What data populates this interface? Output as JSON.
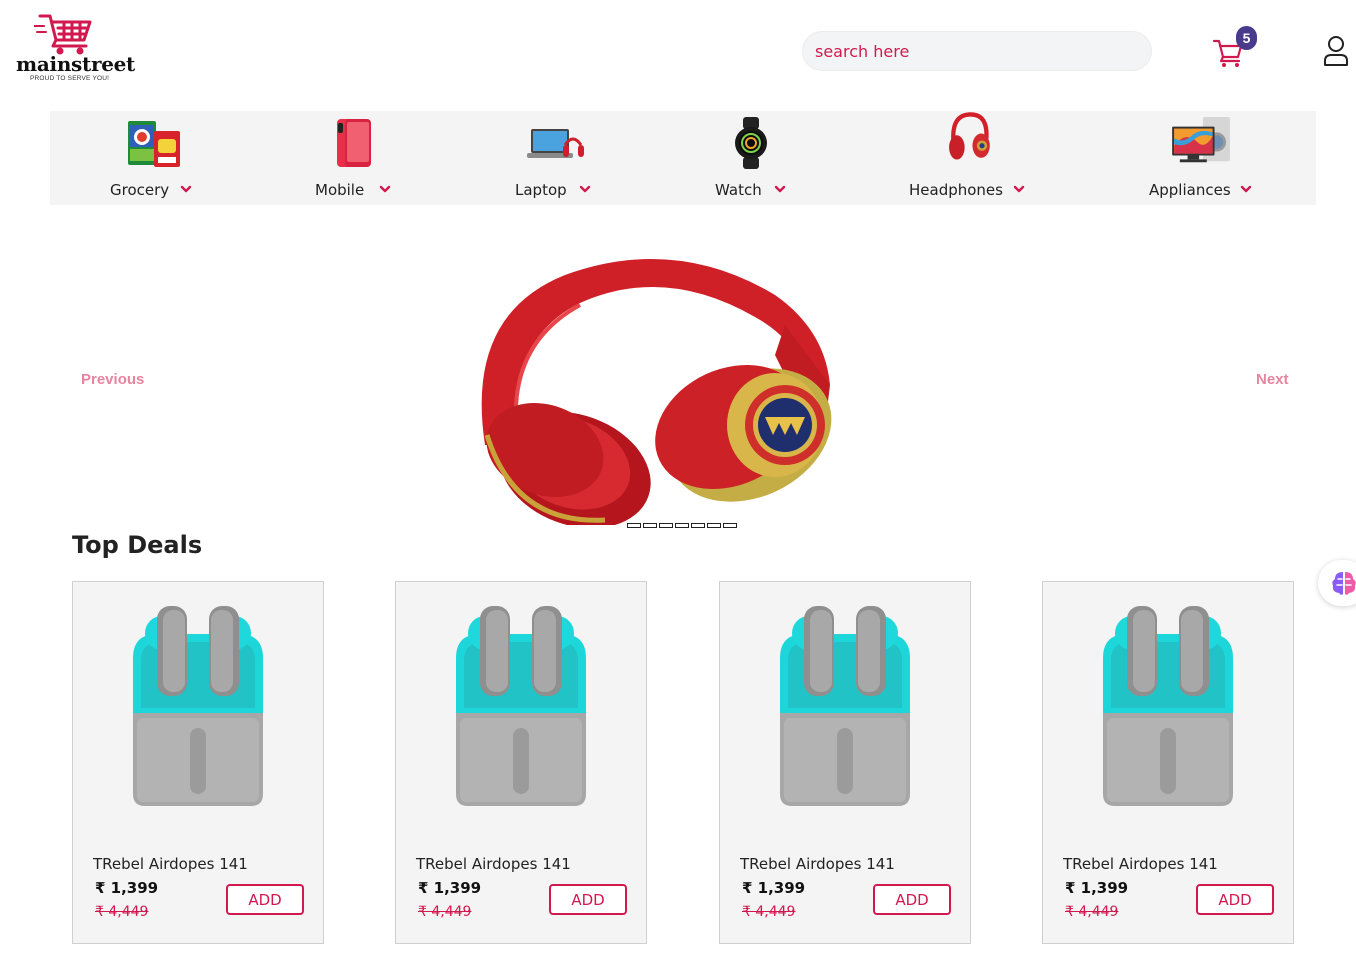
{
  "brand": {
    "name": "mainstreet",
    "tagline": "PROUD TO SERVE YOU!",
    "accent": "#d2194f"
  },
  "search": {
    "placeholder": "search here"
  },
  "cart": {
    "count": "5",
    "icon": "cart-icon"
  },
  "user": {
    "icon": "user-icon"
  },
  "categories": [
    {
      "label": "Grocery",
      "icon": "grocery-image"
    },
    {
      "label": "Mobile",
      "icon": "mobile-image"
    },
    {
      "label": "Laptop",
      "icon": "laptop-image"
    },
    {
      "label": "Watch",
      "icon": "watch-image"
    },
    {
      "label": "Headphones",
      "icon": "headphones-image"
    },
    {
      "label": "Appliances",
      "icon": "appliances-image"
    }
  ],
  "carousel": {
    "prev_label": "Previous",
    "next_label": "Next",
    "hero": "red-headphones-image"
  },
  "deals": {
    "title": "Top Deals",
    "items": [
      {
        "name": "TRebel Airdopes 141",
        "price": "₹ 1,399",
        "mrp": "₹ 4,449",
        "add_label": "ADD"
      },
      {
        "name": "TRebel Airdopes 141",
        "price": "₹ 1,399",
        "mrp": "₹ 4,449",
        "add_label": "ADD"
      },
      {
        "name": "TRebel Airdopes 141",
        "price": "₹ 1,399",
        "mrp": "₹ 4,449",
        "add_label": "ADD"
      },
      {
        "name": "TRebel Airdopes 141",
        "price": "₹ 1,399",
        "mrp": "₹ 4,449",
        "add_label": "ADD"
      }
    ]
  }
}
